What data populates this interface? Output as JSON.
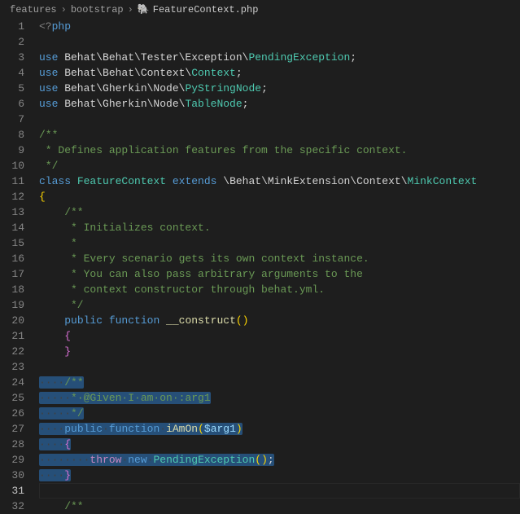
{
  "breadcrumb": {
    "seg1": "features",
    "seg2": "bootstrap",
    "file": "FeatureContext.php",
    "sep": "›"
  },
  "gutter": {
    "start": 1,
    "end": 32,
    "active": 31
  },
  "code": {
    "l1_open": "<?",
    "l1_php": "php",
    "l3_use": "use",
    "l3_ns": " Behat\\Behat\\Tester\\Exception\\",
    "l3_cls": "PendingException",
    "l4_use": "use",
    "l4_ns": " Behat\\Behat\\Context\\",
    "l4_cls": "Context",
    "l5_use": "use",
    "l5_ns": " Behat\\Gherkin\\Node\\",
    "l5_cls": "PyStringNode",
    "l6_use": "use",
    "l6_ns": " Behat\\Gherkin\\Node\\",
    "l6_cls": "TableNode",
    "l8": "/**",
    "l9": " * Defines application features from the specific context.",
    "l10": " */",
    "l11_class": "class",
    "l11_name": " FeatureContext",
    "l11_ext": " extends",
    "l11_ns": " \\Behat\\MinkExtension\\Context\\",
    "l11_cls": "MinkContext",
    "l12": "{",
    "l13": "    /**",
    "l14": "     * Initializes context.",
    "l15": "     *",
    "l16": "     * Every scenario gets its own context instance.",
    "l17": "     * You can also pass arbitrary arguments to the",
    "l18": "     * context constructor through behat.yml.",
    "l19": "     */",
    "l20_pub": "public",
    "l20_fn": " function",
    "l20_name": " __construct",
    "l21": "    {",
    "l22": "    }",
    "l24_ws": "····",
    "l24_c": "/**",
    "l25_ws": "·····",
    "l25_c": "*·@Given·I·am·on·:arg1",
    "l26_ws": "·····",
    "l26_c": "*/",
    "l27_ws": "····",
    "l27_pub": "public",
    "l27_sp1": "·",
    "l27_fn": "function",
    "l27_sp2": "·",
    "l27_name": "iAmOn",
    "l27_p1": "(",
    "l27_arg": "$arg1",
    "l27_p2": ")",
    "l28_ws": "····",
    "l28_b": "{",
    "l29_ws": "········",
    "l29_throw": "throw",
    "l29_sp1": "·",
    "l29_new": "new",
    "l29_sp2": "·",
    "l29_cls": "PendingException",
    "l29_p1": "(",
    "l29_p2": ")",
    "l29_semi": ";",
    "l30_ws": "····",
    "l30_b": "}",
    "l32": "    /**"
  }
}
